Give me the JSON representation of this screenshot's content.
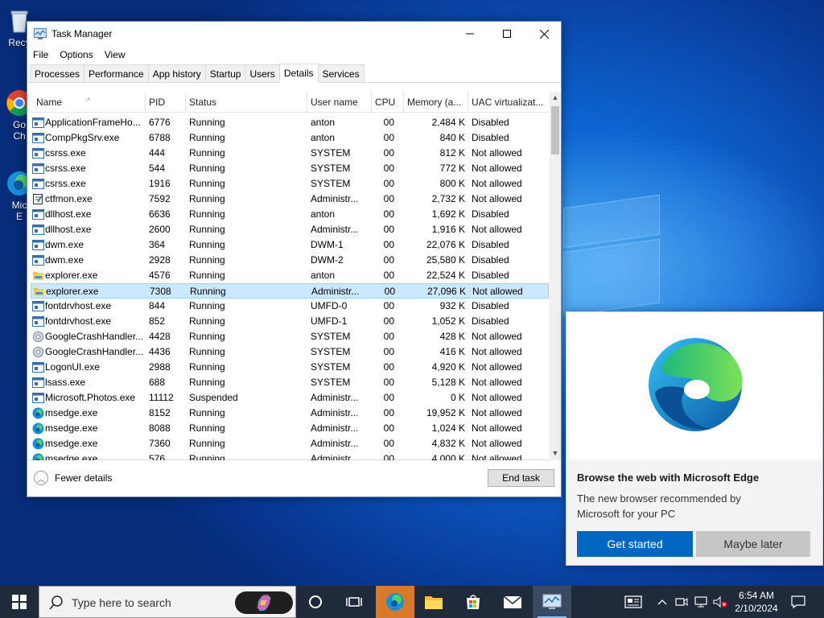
{
  "desktop": {
    "icons": [
      {
        "label": "Recy",
        "name": "recycle-bin"
      },
      {
        "label": "Go\nCh",
        "name": "google-chrome"
      },
      {
        "label": "Mic\nE",
        "name": "microsoft-edge"
      }
    ]
  },
  "task_manager": {
    "title": "Task Manager",
    "menu": [
      "File",
      "Options",
      "View"
    ],
    "tabs": [
      "Processes",
      "Performance",
      "App history",
      "Startup",
      "Users",
      "Details",
      "Services"
    ],
    "active_tab": "Details",
    "columns": [
      "Name",
      "PID",
      "Status",
      "User name",
      "CPU",
      "Memory (a...",
      "UAC virtualizat..."
    ],
    "rows": [
      {
        "icon": "app",
        "name": "ApplicationFrameHo...",
        "pid": "6776",
        "status": "Running",
        "user": "anton",
        "cpu": "00",
        "mem": "2,484 K",
        "uac": "Disabled"
      },
      {
        "icon": "app",
        "name": "CompPkgSrv.exe",
        "pid": "6788",
        "status": "Running",
        "user": "anton",
        "cpu": "00",
        "mem": "840 K",
        "uac": "Disabled"
      },
      {
        "icon": "app",
        "name": "csrss.exe",
        "pid": "444",
        "status": "Running",
        "user": "SYSTEM",
        "cpu": "00",
        "mem": "812 K",
        "uac": "Not allowed"
      },
      {
        "icon": "app",
        "name": "csrss.exe",
        "pid": "544",
        "status": "Running",
        "user": "SYSTEM",
        "cpu": "00",
        "mem": "772 K",
        "uac": "Not allowed"
      },
      {
        "icon": "app",
        "name": "csrss.exe",
        "pid": "1916",
        "status": "Running",
        "user": "SYSTEM",
        "cpu": "00",
        "mem": "800 K",
        "uac": "Not allowed"
      },
      {
        "icon": "notepad",
        "name": "ctfmon.exe",
        "pid": "7592",
        "status": "Running",
        "user": "Administr...",
        "cpu": "00",
        "mem": "2,732 K",
        "uac": "Not allowed"
      },
      {
        "icon": "app",
        "name": "dllhost.exe",
        "pid": "6636",
        "status": "Running",
        "user": "anton",
        "cpu": "00",
        "mem": "1,692 K",
        "uac": "Disabled"
      },
      {
        "icon": "app",
        "name": "dllhost.exe",
        "pid": "2600",
        "status": "Running",
        "user": "Administr...",
        "cpu": "00",
        "mem": "1,916 K",
        "uac": "Not allowed"
      },
      {
        "icon": "app",
        "name": "dwm.exe",
        "pid": "364",
        "status": "Running",
        "user": "DWM-1",
        "cpu": "00",
        "mem": "22,076 K",
        "uac": "Disabled"
      },
      {
        "icon": "app",
        "name": "dwm.exe",
        "pid": "2928",
        "status": "Running",
        "user": "DWM-2",
        "cpu": "00",
        "mem": "25,580 K",
        "uac": "Disabled"
      },
      {
        "icon": "folder",
        "name": "explorer.exe",
        "pid": "4576",
        "status": "Running",
        "user": "anton",
        "cpu": "00",
        "mem": "22,524 K",
        "uac": "Disabled"
      },
      {
        "icon": "folder",
        "name": "explorer.exe",
        "pid": "7308",
        "status": "Running",
        "user": "Administr...",
        "cpu": "00",
        "mem": "27,096 K",
        "uac": "Not allowed",
        "selected": true
      },
      {
        "icon": "app",
        "name": "fontdrvhost.exe",
        "pid": "844",
        "status": "Running",
        "user": "UMFD-0",
        "cpu": "00",
        "mem": "932 K",
        "uac": "Disabled"
      },
      {
        "icon": "app",
        "name": "fontdrvhost.exe",
        "pid": "852",
        "status": "Running",
        "user": "UMFD-1",
        "cpu": "00",
        "mem": "1,052 K",
        "uac": "Disabled"
      },
      {
        "icon": "gear",
        "name": "GoogleCrashHandler...",
        "pid": "4428",
        "status": "Running",
        "user": "SYSTEM",
        "cpu": "00",
        "mem": "428 K",
        "uac": "Not allowed"
      },
      {
        "icon": "gear",
        "name": "GoogleCrashHandler...",
        "pid": "4436",
        "status": "Running",
        "user": "SYSTEM",
        "cpu": "00",
        "mem": "416 K",
        "uac": "Not allowed"
      },
      {
        "icon": "app",
        "name": "LogonUI.exe",
        "pid": "2988",
        "status": "Running",
        "user": "SYSTEM",
        "cpu": "00",
        "mem": "4,920 K",
        "uac": "Not allowed"
      },
      {
        "icon": "app",
        "name": "lsass.exe",
        "pid": "688",
        "status": "Running",
        "user": "SYSTEM",
        "cpu": "00",
        "mem": "5,128 K",
        "uac": "Not allowed"
      },
      {
        "icon": "app",
        "name": "Microsoft.Photos.exe",
        "pid": "11112",
        "status": "Suspended",
        "user": "Administr...",
        "cpu": "00",
        "mem": "0 K",
        "uac": "Not allowed"
      },
      {
        "icon": "edge",
        "name": "msedge.exe",
        "pid": "8152",
        "status": "Running",
        "user": "Administr...",
        "cpu": "00",
        "mem": "19,952 K",
        "uac": "Not allowed"
      },
      {
        "icon": "edge",
        "name": "msedge.exe",
        "pid": "8088",
        "status": "Running",
        "user": "Administr...",
        "cpu": "00",
        "mem": "1,024 K",
        "uac": "Not allowed"
      },
      {
        "icon": "edge",
        "name": "msedge.exe",
        "pid": "7360",
        "status": "Running",
        "user": "Administr...",
        "cpu": "00",
        "mem": "4,832 K",
        "uac": "Not allowed"
      },
      {
        "icon": "edge",
        "name": "msedge.exe",
        "pid": "576",
        "status": "Running",
        "user": "Administr...",
        "cpu": "00",
        "mem": "4,000 K",
        "uac": "Not allowed"
      }
    ],
    "fewer_details": "Fewer details",
    "end_task": "End task"
  },
  "edge_popup": {
    "title": "Browse the web with Microsoft Edge",
    "description": "The new browser recommended by Microsoft for your PC",
    "primary_button": "Get started",
    "secondary_button": "Maybe later"
  },
  "taskbar": {
    "search_placeholder": "Type here to search",
    "time": "6:54 AM",
    "date": "2/10/2024"
  }
}
